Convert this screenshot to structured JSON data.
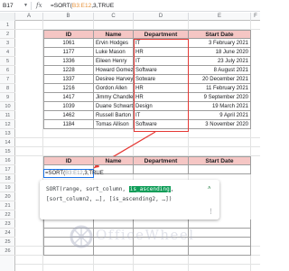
{
  "formula_bar": {
    "cell_ref": "B17",
    "fx": "fx",
    "formula_prefix": "=SORT(",
    "formula_range": "B3:E12",
    "formula_suffix": ",3,TRUE"
  },
  "columns": [
    "A",
    "B",
    "C",
    "D",
    "E",
    "F"
  ],
  "rows": [
    "1",
    "2",
    "3",
    "4",
    "5",
    "6",
    "7",
    "8",
    "9",
    "10",
    "11",
    "12",
    "13",
    "14",
    "15",
    "16",
    "17",
    "18",
    "19",
    "20",
    "21",
    "22",
    "23",
    "24",
    "25",
    "26"
  ],
  "source_table": {
    "headers": [
      "ID",
      "Name",
      "Department",
      "Start Date"
    ],
    "rows": [
      {
        "id": "1061",
        "name": "Ervin Hodges",
        "dept": "IT",
        "date": "3 February 2021"
      },
      {
        "id": "1177",
        "name": "Luke Mason",
        "dept": "HR",
        "date": "18 June 2020"
      },
      {
        "id": "1336",
        "name": "Eileen Henry",
        "dept": "IT",
        "date": "23 July 2021"
      },
      {
        "id": "1228",
        "name": "Howard Gomez",
        "dept": "Software",
        "date": "8 August 2021"
      },
      {
        "id": "1337",
        "name": "Desiree Harvey",
        "dept": "Sotware",
        "date": "20 December 2021"
      },
      {
        "id": "1216",
        "name": "Gordon Allen",
        "dept": "HR",
        "date": "11 February 2021"
      },
      {
        "id": "1417",
        "name": "Jimmy Chandler",
        "dept": "HR",
        "date": "9 September 2020"
      },
      {
        "id": "1039",
        "name": "Duane Schwartz",
        "dept": "Design",
        "date": "19 March 2021"
      },
      {
        "id": "1462",
        "name": "Russell Barton",
        "dept": "IT",
        "date": "9 April 2021"
      },
      {
        "id": "1184",
        "name": "Tomas Allison",
        "dept": "Software",
        "date": "3 November 2020"
      }
    ]
  },
  "result_table": {
    "headers": [
      "ID",
      "Name",
      "Department",
      "Start Date"
    ]
  },
  "active_cell": {
    "prefix": "=SORT(",
    "range": "B3:E12",
    "suffix": ",3,TRUE"
  },
  "tooltip": {
    "line1_pre": "SORT(range, sort_column, ",
    "line1_hl": "is_ascending",
    "line1_post": ",",
    "line2": "[sort_column2, …], [is_ascending2, …])",
    "chevron": "˄",
    "more": "⋮"
  },
  "watermark": {
    "text": "OfficeWheel"
  },
  "colors": {
    "header_red": "#f5c6c4",
    "header_green": "#c5e0b4",
    "highlight_box": "#e53935",
    "active_border": "#1a73e8",
    "param_highlight": "#0f9d58"
  }
}
